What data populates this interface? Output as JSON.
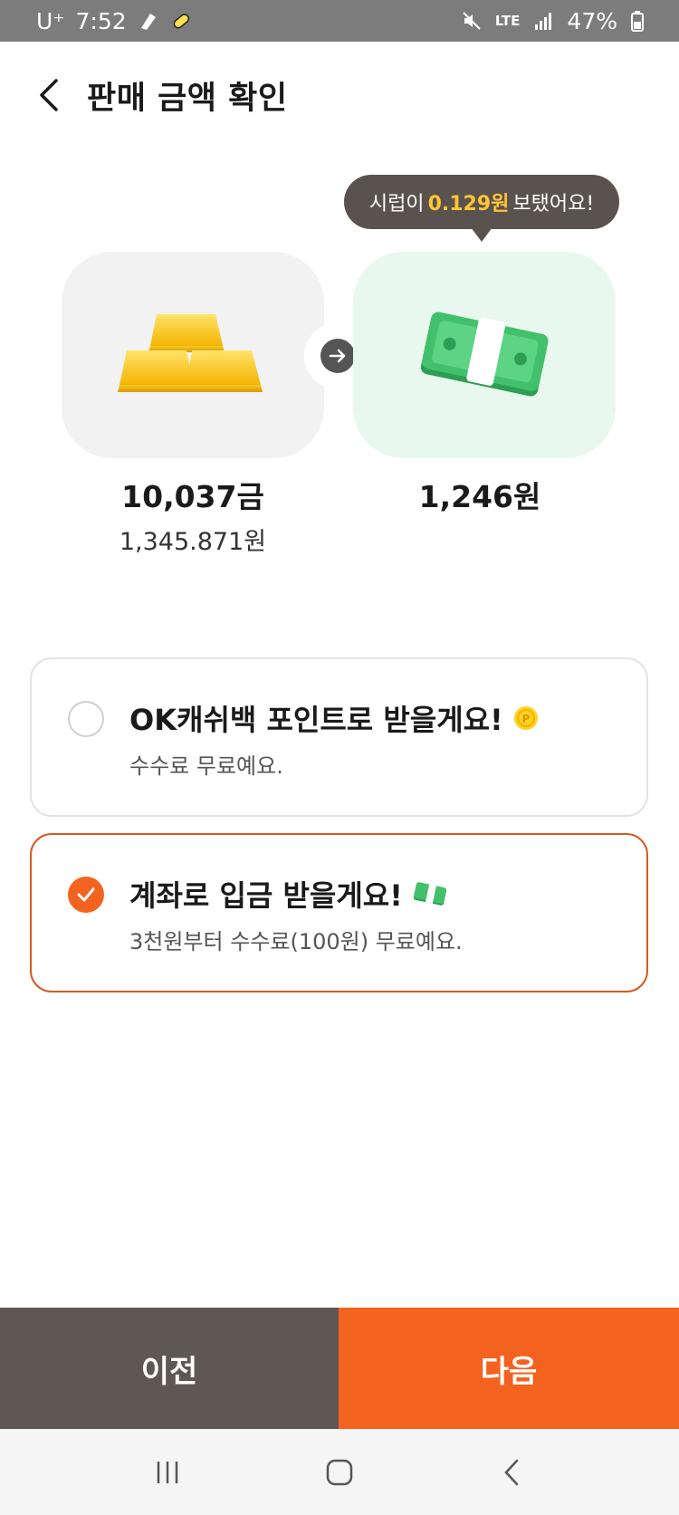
{
  "status_bar": {
    "carrier": "U⁺",
    "time": "7:52",
    "network": "LTE",
    "battery": "47%"
  },
  "header": {
    "title": "판매 금액 확인"
  },
  "tooltip": {
    "prefix": "시럽이",
    "highlight": "0.129원",
    "suffix": "보탰어요!"
  },
  "conversion": {
    "gold_amount": "10,037금",
    "gold_value": "1,345.871원",
    "cash_amount": "1,246원"
  },
  "options": [
    {
      "title": "OK캐쉬백 포인트로 받을게요!",
      "desc": "수수료 무료예요.",
      "selected": false
    },
    {
      "title": "계좌로 입금 받을게요!",
      "desc": "3천원부터 수수료(100원) 무료예요.",
      "selected": true
    }
  ],
  "buttons": {
    "prev": "이전",
    "next": "다음"
  },
  "colors": {
    "accent": "#f4621f",
    "dark_button": "#5f5753",
    "tooltip_bg": "#5a524e",
    "highlight": "#ffc533"
  }
}
